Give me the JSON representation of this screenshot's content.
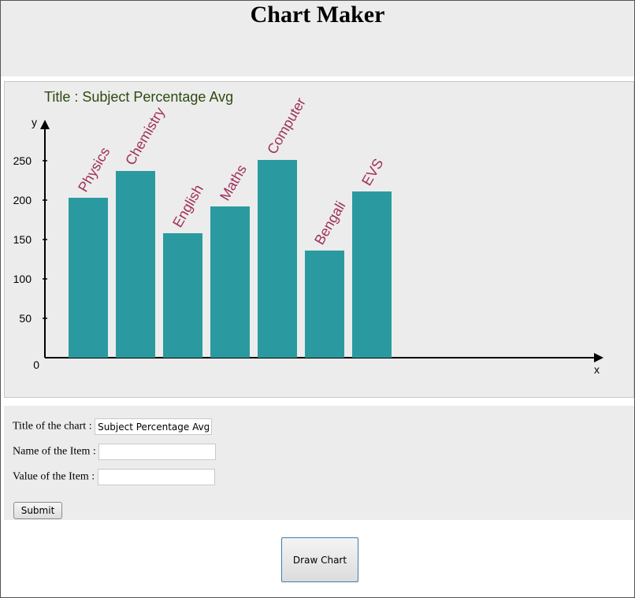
{
  "page": {
    "title": "Chart Maker"
  },
  "chart_data": {
    "type": "bar",
    "title": "Title : Subject Percentage Avg",
    "categories": [
      "Physics",
      "Chemistry",
      "English",
      "Maths",
      "Computer",
      "Bengali",
      "EVS"
    ],
    "values": [
      203,
      237,
      158,
      192,
      251,
      136,
      211
    ],
    "xlabel": "x",
    "ylabel": "y",
    "yticks": [
      0,
      50,
      100,
      150,
      200,
      250
    ],
    "ylim": [
      0,
      300
    ],
    "grid": false,
    "colors": {
      "bar": "#2a9aa0",
      "label": "#a0305a",
      "title": "#2e4a10",
      "axis": "#000000"
    }
  },
  "form": {
    "title_label": "Title of the chart :",
    "title_value": "Subject Percentage Avg",
    "name_label": "Name of the Item :",
    "name_value": "",
    "value_label": "Value of the Item :",
    "value_value": "",
    "submit_label": "Submit"
  },
  "actions": {
    "draw_chart_label": "Draw Chart"
  }
}
